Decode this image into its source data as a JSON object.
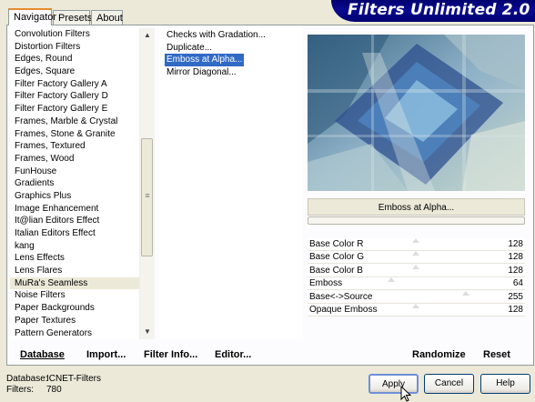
{
  "tabs": [
    "Navigator",
    "Presets",
    "About"
  ],
  "banner_title": "Filters Unlimited 2.0",
  "categories": [
    "Convolution Filters",
    "Distortion Filters",
    "Edges, Round",
    "Edges, Square",
    "Filter Factory Gallery A",
    "Filter Factory Gallery D",
    "Filter Factory Gallery E",
    "Frames, Marble & Crystal",
    "Frames, Stone & Granite",
    "Frames, Textured",
    "Frames, Wood",
    "FunHouse",
    "Gradients",
    "Graphics Plus",
    "Image Enhancement",
    "It@lian Editors Effect",
    "Italian Editors Effect",
    "kang",
    "Lens Effects",
    "Lens Flares",
    "MuRa's Seamless",
    "Noise Filters",
    "Paper Backgrounds",
    "Paper Textures",
    "Pattern Generators"
  ],
  "selected_category": "MuRa's Seamless",
  "filters": [
    "Checks with Gradation...",
    "Duplicate...",
    "Emboss at Alpha...",
    "Mirror Diagonal..."
  ],
  "selected_filter": "Emboss at Alpha...",
  "filter_name_display": "Emboss at Alpha...",
  "params": [
    {
      "label": "Base Color R",
      "value": "128"
    },
    {
      "label": "Base Color G",
      "value": "128"
    },
    {
      "label": "Base Color B",
      "value": "128"
    },
    {
      "label": "Emboss",
      "value": "64"
    },
    {
      "label": "Base<->Source",
      "value": "255"
    },
    {
      "label": "Opaque Emboss",
      "value": "128"
    }
  ],
  "bottom_links": {
    "database": "Database",
    "import": "Import...",
    "filter_info": "Filter Info...",
    "editor": "Editor...",
    "randomize": "Randomize",
    "reset": "Reset"
  },
  "info": {
    "database_label": "Database:",
    "database_value": "ICNET-Filters",
    "filters_label": "Filters:",
    "filters_value": "780"
  },
  "buttons": {
    "apply": "Apply",
    "cancel": "Cancel",
    "help": "Help"
  },
  "icons": {
    "scroll_up": "arrow-up-icon",
    "scroll_down": "arrow-down-icon",
    "grip": "scroll-grip-icon",
    "cursor": "mouse-cursor-icon"
  },
  "colors": {
    "selection": "#316ac5",
    "banner": "#020070",
    "tab_accent": "#e68b2c"
  }
}
